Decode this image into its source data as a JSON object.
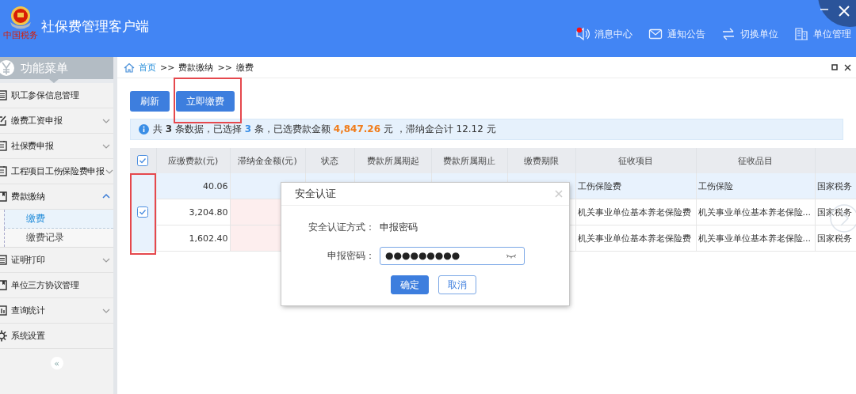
{
  "header": {
    "title": "社保费管理客户端",
    "logo_text": "中国税务",
    "nav": [
      {
        "kind": "message",
        "label": "消息中心",
        "unread": true
      },
      {
        "kind": "notice",
        "label": "通知公告"
      },
      {
        "kind": "switch",
        "label": "切换单位"
      },
      {
        "kind": "unit",
        "label": "单位管理"
      }
    ]
  },
  "sidebar": {
    "title": "功能菜单",
    "items": [
      {
        "kind": "link",
        "label": "职工参保信息管理"
      },
      {
        "kind": "group",
        "label": "缴费工资申报",
        "expanded": false
      },
      {
        "kind": "group",
        "label": "社保费申报",
        "expanded": false
      },
      {
        "kind": "group",
        "label": "工程项目工伤保险费申报",
        "expanded": false
      },
      {
        "kind": "group",
        "label": "费款缴纳",
        "expanded": true,
        "children": [
          {
            "label": "缴费",
            "selected": true
          },
          {
            "label": "缴费记录",
            "selected": false
          }
        ]
      },
      {
        "kind": "group",
        "label": "证明打印",
        "expanded": false
      },
      {
        "kind": "link",
        "label": "单位三方协议管理"
      },
      {
        "kind": "group",
        "label": "查询统计",
        "expanded": false
      },
      {
        "kind": "link",
        "label": "系统设置"
      }
    ],
    "collapse": "«"
  },
  "breadcrumb": {
    "items": [
      {
        "label": "首页",
        "link": true
      },
      {
        "label": "费款缴纳",
        "link": false
      },
      {
        "label": "缴费",
        "link": false
      }
    ],
    "separator": ">>"
  },
  "toolbar": [
    {
      "label": "刷新"
    },
    {
      "label": "立即缴费"
    }
  ],
  "annotations": {
    "pay_button_framed": true,
    "select_column_framed": true
  },
  "info": [
    {
      "kind": "plain",
      "text": "共 "
    },
    {
      "kind": "bold",
      "text": "3"
    },
    {
      "kind": "plain",
      "text": " 条数据，已选择 "
    },
    {
      "kind": "count",
      "text": "3"
    },
    {
      "kind": "plain",
      "text": " 条，已选费款金额 "
    },
    {
      "kind": "amount",
      "text": "4,847.26"
    },
    {
      "kind": "plain",
      "text": " 元 ，滞纳金合计 12.12 元"
    }
  ],
  "table": {
    "select_all_checked": true,
    "rows_checked": true,
    "columns": [
      "应缴费款(元)",
      "滞纳金金额(元)",
      "状态",
      "费款所属期起",
      "费款所属期止",
      "缴费期限",
      "征收项目",
      "征收品目",
      null
    ],
    "rows": [
      {
        "selected": true,
        "fee_cell_tinted": false,
        "cells": [
          "40.06",
          null,
          null,
          null,
          null,
          null,
          "工伤保险费",
          "工伤保险",
          "国家税务"
        ]
      },
      {
        "selected": false,
        "fee_cell_tinted": true,
        "cells": [
          "3,204.80",
          null,
          null,
          null,
          null,
          null,
          "机关事业单位基本养老保险费",
          "机关事业单位基本养老保险...",
          "国家税务"
        ]
      },
      {
        "selected": false,
        "fee_cell_tinted": true,
        "cells": [
          "1,602.40",
          null,
          null,
          null,
          null,
          null,
          "机关事业单位基本养老保险费",
          "机关事业单位基本养老保险...",
          "国家税务"
        ]
      }
    ]
  },
  "dialog": {
    "title": "安全认证",
    "method_label": "安全认证方式：",
    "method_value": "申报密码",
    "password_label": "申报密码：",
    "password": "●●●●●●●●●",
    "password_visible": false,
    "buttons": [
      {
        "kind": "primary",
        "label": "确定"
      },
      {
        "kind": "default",
        "label": "取消"
      }
    ]
  }
}
